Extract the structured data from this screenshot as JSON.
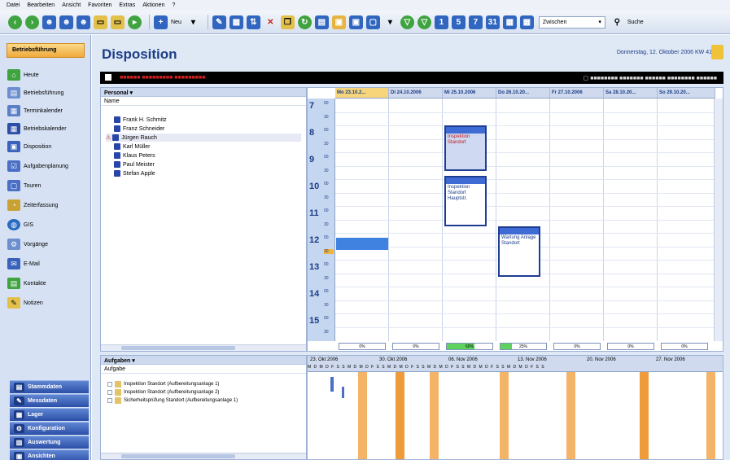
{
  "menu": [
    "Datei",
    "Bearbeiten",
    "Ansicht",
    "Favoriten",
    "Extras",
    "Aktionen",
    "?"
  ],
  "toolbar": {
    "new_label": "Neu",
    "dropdown_value": "Zwischen",
    "search_label": "Suche"
  },
  "left_nav": {
    "header": "Betriebsführung",
    "items": [
      {
        "label": "Heute",
        "icon": "house-icon"
      },
      {
        "label": "Betriebsführung",
        "icon": "document-icon"
      },
      {
        "label": "Terminkalender",
        "icon": "calendar-icon"
      },
      {
        "label": "Betriebskalender",
        "icon": "calendar-icon"
      },
      {
        "label": "Disposition",
        "icon": "dispatch-icon"
      },
      {
        "label": "Aufgabenplanung",
        "icon": "task-icon"
      },
      {
        "label": "Touren",
        "icon": "route-icon"
      },
      {
        "label": "Zeiterfassung",
        "icon": "clock-icon"
      },
      {
        "label": "GIS",
        "icon": "globe-icon"
      },
      {
        "label": "Vorgänge",
        "icon": "process-icon"
      },
      {
        "label": "E-Mail",
        "icon": "mail-icon"
      },
      {
        "label": "Kontakte",
        "icon": "contacts-icon"
      },
      {
        "label": "Notizen",
        "icon": "note-icon"
      }
    ],
    "bottom_buttons": [
      {
        "label": "Stammdaten",
        "icon": "database-icon"
      },
      {
        "label": "Messdaten",
        "icon": "measure-icon"
      },
      {
        "label": "Lager",
        "icon": "warehouse-icon"
      },
      {
        "label": "Konfiguration",
        "icon": "config-icon"
      },
      {
        "label": "Auswertung",
        "icon": "report-icon"
      },
      {
        "label": "Ansichten",
        "icon": "views-icon"
      }
    ]
  },
  "page": {
    "title": "Disposition",
    "date": "Donnerstag, 12. Oktober 2006 KW 41"
  },
  "personal": {
    "header": "Personal",
    "subheader": "Name",
    "people": [
      "Frank H. Schmitz",
      "Franz Schneider",
      "Jürgen Rauch",
      "Karl Müller",
      "Klaus Peters",
      "Paul Meister",
      "Stefan Apple"
    ]
  },
  "calendar": {
    "days": [
      "Mo 23.10.2...",
      "Di 24.10.2006",
      "Mi 25.10.2006",
      "Do 26.10.20...",
      "Fr 27.10.2006",
      "Sa 28.10.20...",
      "So 29.10.20..."
    ],
    "hours": [
      "7",
      "8",
      "9",
      "10",
      "11",
      "12",
      "13",
      "14",
      "15"
    ],
    "minutes": "00",
    "half": "30",
    "appointments": [
      {
        "title": "Inspektion Standort",
        "style": "red"
      },
      {
        "title": "Inspektion Standort Hauptstr.",
        "style": "normal"
      },
      {
        "title": "Wartung Anlage Standort",
        "style": "normal"
      }
    ],
    "utilization": [
      {
        "label": "0%",
        "value": 0
      },
      {
        "label": "0%",
        "value": 0
      },
      {
        "label": "60%",
        "value": 0.6
      },
      {
        "label": "25%",
        "value": 0.25
      },
      {
        "label": "0%",
        "value": 0
      },
      {
        "label": "0%",
        "value": 0
      },
      {
        "label": "0%",
        "value": 0
      }
    ]
  },
  "tasks": {
    "header": "Aufgaben",
    "subheader": "Aufgabe",
    "items": [
      "Inspektion Standort (Aufbereitungsanlage 1)",
      "Inspektion Standort (Aufbereitungsanlage 2)",
      "Sicherheitsprüfung Standort (Aufbereitungsanlage 1)"
    ]
  },
  "gantt": {
    "weeks": [
      "23. Okt 2006",
      "30. Okt 2006",
      "06. Nov 2006",
      "13. Nov 2006",
      "20. Nov 2006",
      "27. Nov 2006"
    ],
    "day_letters": "M D M D F S S M D M D F S S M D M D F S S M D M D F S S M D M D F S S M D M D F S S"
  },
  "colors": {
    "accent": "#1d3d86",
    "header_orange": "#f0a93b",
    "gantt_orange": "#f4b467",
    "util_green": "#5dd35d"
  }
}
